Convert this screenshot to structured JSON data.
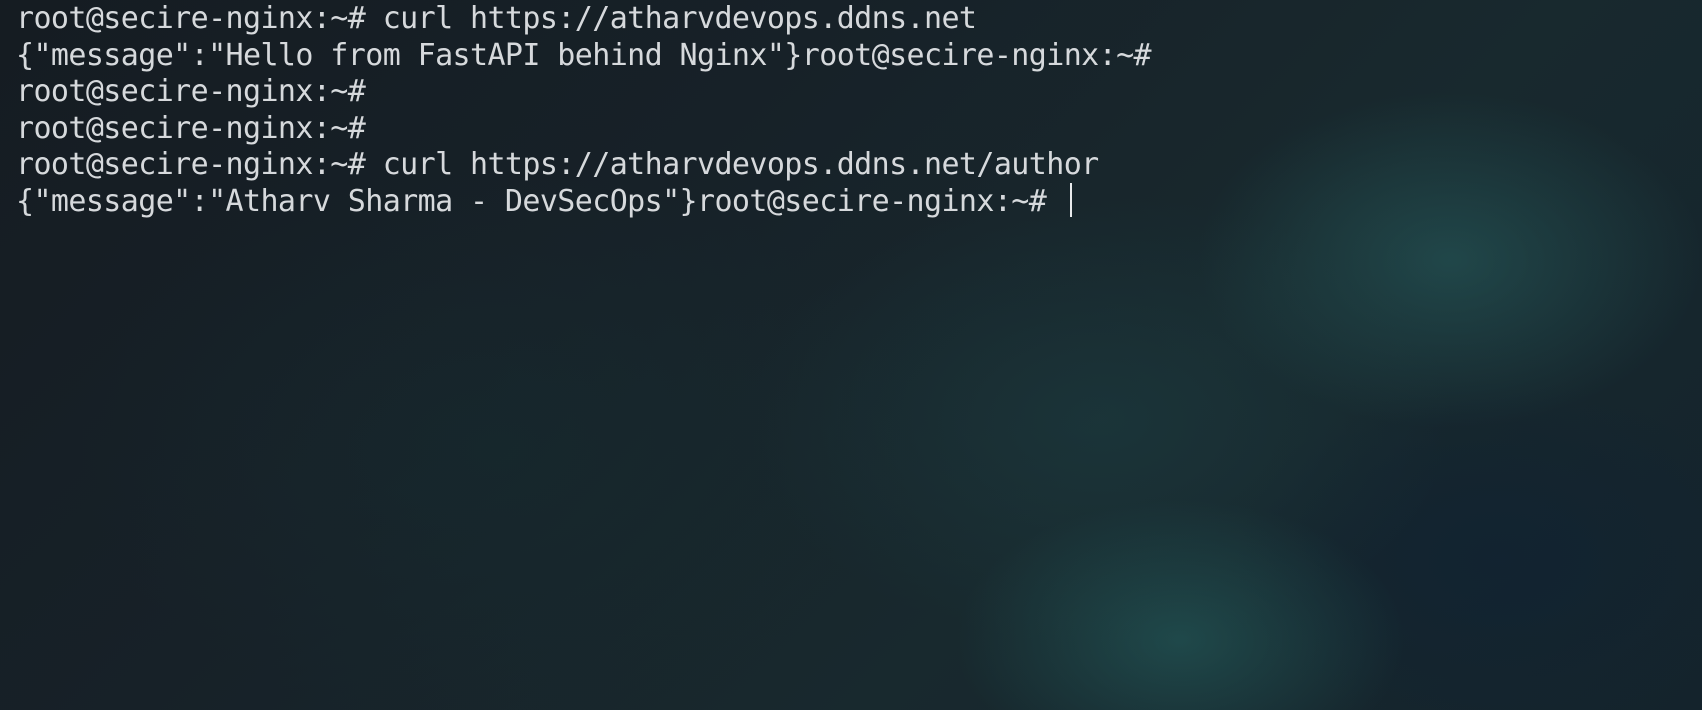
{
  "terminal": {
    "lines": [
      "root@secire-nginx:~# curl https://atharvdevops.ddns.net",
      "{\"message\":\"Hello from FastAPI behind Nginx\"}root@secire-nginx:~#",
      "root@secire-nginx:~#",
      "root@secire-nginx:~#",
      "root@secire-nginx:~# curl https://atharvdevops.ddns.net/author",
      "{\"message\":\"Atharv Sharma - DevSecOps\"}root@secire-nginx:~# "
    ]
  }
}
